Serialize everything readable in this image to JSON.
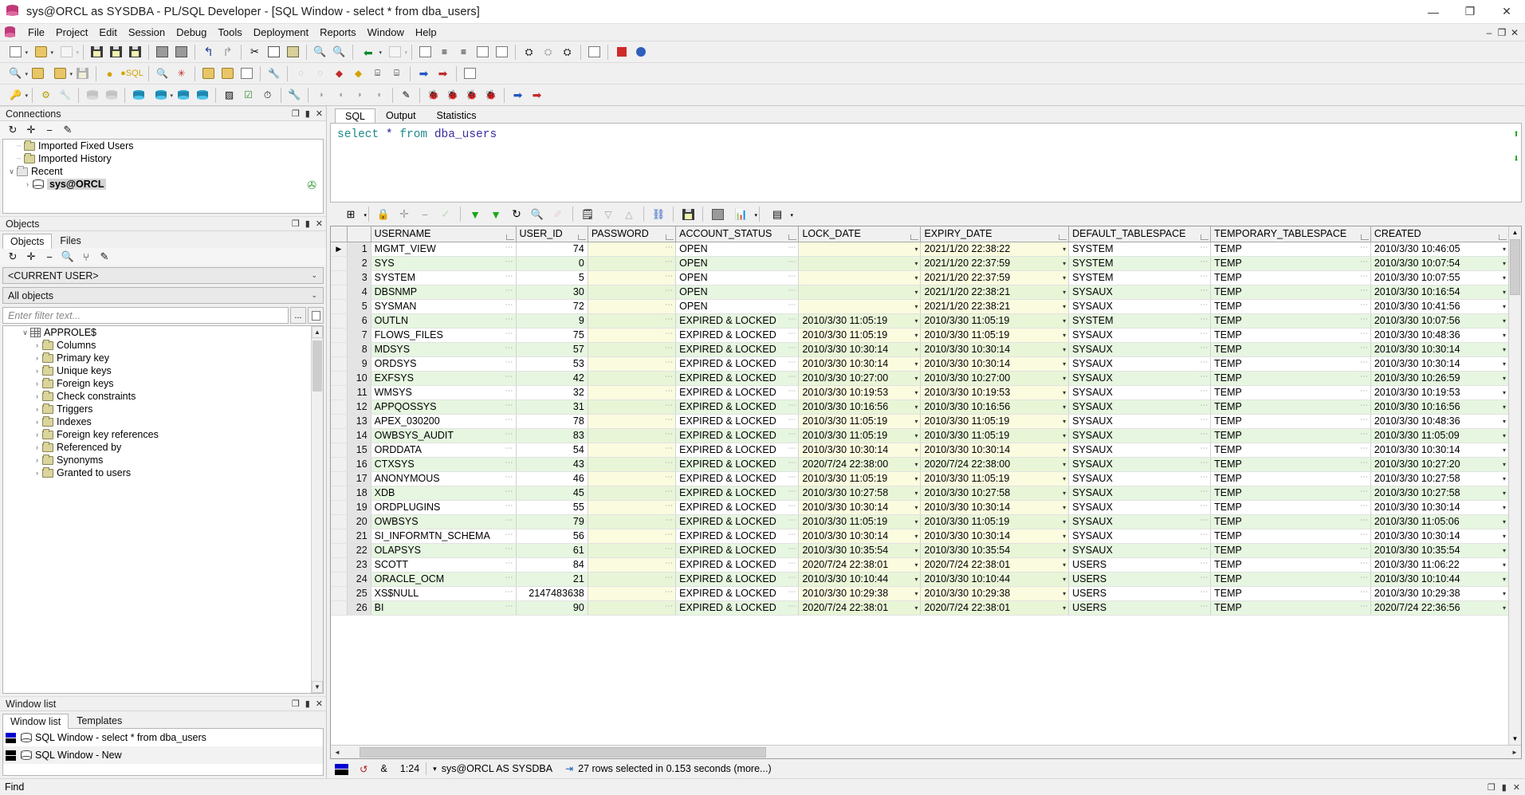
{
  "window": {
    "title": "sys@ORCL as SYSDBA - PL/SQL Developer - [SQL Window - select * from dba_users]",
    "minimize": "—",
    "maximize": "❐",
    "close": "✕",
    "mdi_minimize": "–",
    "mdi_restore": "❐",
    "mdi_close": "✕"
  },
  "menu": {
    "items": [
      "File",
      "Project",
      "Edit",
      "Session",
      "Debug",
      "Tools",
      "Deployment",
      "Reports",
      "Window",
      "Help"
    ]
  },
  "connections_panel": {
    "title": "Connections",
    "controls": {
      "float": "❐",
      "pin": "▮",
      "close": "✕"
    },
    "toolbar": [
      "refresh-icon",
      "add-icon",
      "remove-icon",
      "edit-icon"
    ],
    "tree": [
      {
        "label": "Imported Fixed Users",
        "icon": "folder-icon",
        "expander": "",
        "level": 1
      },
      {
        "label": "Imported History",
        "icon": "folder-icon",
        "expander": "",
        "level": 1
      },
      {
        "label": "Recent",
        "icon": "folder-grey-icon",
        "expander": "∨",
        "level": 0
      },
      {
        "label": "sys@ORCL",
        "icon": "connection-icon",
        "expander": "›",
        "level": 2,
        "selected": true
      }
    ]
  },
  "objects_panel": {
    "title": "Objects",
    "controls": {
      "float": "❐",
      "pin": "▮",
      "close": "✕"
    },
    "tabs": [
      {
        "label": "Objects",
        "active": true
      },
      {
        "label": "Files",
        "active": false
      }
    ],
    "toolbar": [
      "refresh-icon",
      "add-icon",
      "remove-icon",
      "find-icon",
      "filter-icon",
      "edit-icon"
    ],
    "user_select": "<CURRENT USER>",
    "object_select": "All objects",
    "filter_placeholder": "Enter filter text...",
    "filter_buttons": [
      "...",
      "report-icon"
    ],
    "tree": [
      {
        "label": "APPROLE$",
        "icon": "table-icon",
        "expander": "∨",
        "level": 1
      },
      {
        "label": "Columns",
        "icon": "folder-icon",
        "expander": "›",
        "level": 2
      },
      {
        "label": "Primary key",
        "icon": "folder-icon",
        "expander": "›",
        "level": 2
      },
      {
        "label": "Unique keys",
        "icon": "folder-icon",
        "expander": "›",
        "level": 2
      },
      {
        "label": "Foreign keys",
        "icon": "folder-icon",
        "expander": "›",
        "level": 2
      },
      {
        "label": "Check constraints",
        "icon": "folder-icon",
        "expander": "›",
        "level": 2
      },
      {
        "label": "Triggers",
        "icon": "folder-icon",
        "expander": "›",
        "level": 2
      },
      {
        "label": "Indexes",
        "icon": "folder-icon",
        "expander": "›",
        "level": 2
      },
      {
        "label": "Foreign key references",
        "icon": "folder-icon",
        "expander": "›",
        "level": 2
      },
      {
        "label": "Referenced by",
        "icon": "folder-icon",
        "expander": "›",
        "level": 2
      },
      {
        "label": "Synonyms",
        "icon": "folder-icon",
        "expander": "›",
        "level": 2
      },
      {
        "label": "Granted to users",
        "icon": "folder-icon",
        "expander": "›",
        "level": 2
      }
    ]
  },
  "window_list_panel": {
    "title": "Window list",
    "controls": {
      "float": "❐",
      "pin": "▮",
      "close": "✕"
    },
    "tabs": [
      {
        "label": "Window list",
        "active": true
      },
      {
        "label": "Templates",
        "active": false
      }
    ],
    "items": [
      {
        "label": "SQL Window - select * from dba_users",
        "active": true
      },
      {
        "label": "SQL Window - New",
        "active": false
      }
    ]
  },
  "editor": {
    "tabs": [
      {
        "label": "SQL",
        "active": true
      },
      {
        "label": "Output",
        "active": false
      },
      {
        "label": "Statistics",
        "active": false
      }
    ],
    "sql_tokens": [
      {
        "text": "select",
        "type": "keyword"
      },
      {
        "text": " ",
        "type": "plain"
      },
      {
        "text": "*",
        "type": "star"
      },
      {
        "text": " ",
        "type": "plain"
      },
      {
        "text": "from",
        "type": "keyword"
      },
      {
        "text": " ",
        "type": "plain"
      },
      {
        "text": "dba_users",
        "type": "identifier"
      }
    ],
    "sql_text": "select * from dba_users"
  },
  "grid_toolbar": {
    "buttons": [
      "grid-layout-icon",
      "lock-icon",
      "insert-row-icon",
      "delete-row-icon",
      "post-changes-icon",
      "export-all-icon",
      "fetch-all-icon",
      "refresh-icon",
      "find-icon",
      "clear-icon",
      "copy-data-icon",
      "sort-desc-icon",
      "sort-asc-icon",
      "link-icon",
      "save-icon",
      "print-icon",
      "chart-icon",
      "table-view-icon"
    ]
  },
  "grid": {
    "columns": [
      "USERNAME",
      "USER_ID",
      "PASSWORD",
      "ACCOUNT_STATUS",
      "LOCK_DATE",
      "EXPIRY_DATE",
      "DEFAULT_TABLESPACE",
      "TEMPORARY_TABLESPACE",
      "CREATED"
    ],
    "rows": [
      {
        "n": 1,
        "USERNAME": "MGMT_VIEW",
        "USER_ID": "74",
        "PASSWORD": "",
        "ACCOUNT_STATUS": "OPEN",
        "LOCK_DATE": "",
        "EXPIRY_DATE": "2021/1/20 22:38:22",
        "DEFAULT_TABLESPACE": "SYSTEM",
        "TEMPORARY_TABLESPACE": "TEMP",
        "CREATED": "2010/3/30 10:46:05"
      },
      {
        "n": 2,
        "USERNAME": "SYS",
        "USER_ID": "0",
        "PASSWORD": "",
        "ACCOUNT_STATUS": "OPEN",
        "LOCK_DATE": "",
        "EXPIRY_DATE": "2021/1/20 22:37:59",
        "DEFAULT_TABLESPACE": "SYSTEM",
        "TEMPORARY_TABLESPACE": "TEMP",
        "CREATED": "2010/3/30 10:07:54"
      },
      {
        "n": 3,
        "USERNAME": "SYSTEM",
        "USER_ID": "5",
        "PASSWORD": "",
        "ACCOUNT_STATUS": "OPEN",
        "LOCK_DATE": "",
        "EXPIRY_DATE": "2021/1/20 22:37:59",
        "DEFAULT_TABLESPACE": "SYSTEM",
        "TEMPORARY_TABLESPACE": "TEMP",
        "CREATED": "2010/3/30 10:07:55"
      },
      {
        "n": 4,
        "USERNAME": "DBSNMP",
        "USER_ID": "30",
        "PASSWORD": "",
        "ACCOUNT_STATUS": "OPEN",
        "LOCK_DATE": "",
        "EXPIRY_DATE": "2021/1/20 22:38:21",
        "DEFAULT_TABLESPACE": "SYSAUX",
        "TEMPORARY_TABLESPACE": "TEMP",
        "CREATED": "2010/3/30 10:16:54"
      },
      {
        "n": 5,
        "USERNAME": "SYSMAN",
        "USER_ID": "72",
        "PASSWORD": "",
        "ACCOUNT_STATUS": "OPEN",
        "LOCK_DATE": "",
        "EXPIRY_DATE": "2021/1/20 22:38:21",
        "DEFAULT_TABLESPACE": "SYSAUX",
        "TEMPORARY_TABLESPACE": "TEMP",
        "CREATED": "2010/3/30 10:41:56"
      },
      {
        "n": 6,
        "USERNAME": "OUTLN",
        "USER_ID": "9",
        "PASSWORD": "",
        "ACCOUNT_STATUS": "EXPIRED & LOCKED",
        "LOCK_DATE": "2010/3/30 11:05:19",
        "EXPIRY_DATE": "2010/3/30 11:05:19",
        "DEFAULT_TABLESPACE": "SYSTEM",
        "TEMPORARY_TABLESPACE": "TEMP",
        "CREATED": "2010/3/30 10:07:56"
      },
      {
        "n": 7,
        "USERNAME": "FLOWS_FILES",
        "USER_ID": "75",
        "PASSWORD": "",
        "ACCOUNT_STATUS": "EXPIRED & LOCKED",
        "LOCK_DATE": "2010/3/30 11:05:19",
        "EXPIRY_DATE": "2010/3/30 11:05:19",
        "DEFAULT_TABLESPACE": "SYSAUX",
        "TEMPORARY_TABLESPACE": "TEMP",
        "CREATED": "2010/3/30 10:48:36"
      },
      {
        "n": 8,
        "USERNAME": "MDSYS",
        "USER_ID": "57",
        "PASSWORD": "",
        "ACCOUNT_STATUS": "EXPIRED & LOCKED",
        "LOCK_DATE": "2010/3/30 10:30:14",
        "EXPIRY_DATE": "2010/3/30 10:30:14",
        "DEFAULT_TABLESPACE": "SYSAUX",
        "TEMPORARY_TABLESPACE": "TEMP",
        "CREATED": "2010/3/30 10:30:14"
      },
      {
        "n": 9,
        "USERNAME": "ORDSYS",
        "USER_ID": "53",
        "PASSWORD": "",
        "ACCOUNT_STATUS": "EXPIRED & LOCKED",
        "LOCK_DATE": "2010/3/30 10:30:14",
        "EXPIRY_DATE": "2010/3/30 10:30:14",
        "DEFAULT_TABLESPACE": "SYSAUX",
        "TEMPORARY_TABLESPACE": "TEMP",
        "CREATED": "2010/3/30 10:30:14"
      },
      {
        "n": 10,
        "USERNAME": "EXFSYS",
        "USER_ID": "42",
        "PASSWORD": "",
        "ACCOUNT_STATUS": "EXPIRED & LOCKED",
        "LOCK_DATE": "2010/3/30 10:27:00",
        "EXPIRY_DATE": "2010/3/30 10:27:00",
        "DEFAULT_TABLESPACE": "SYSAUX",
        "TEMPORARY_TABLESPACE": "TEMP",
        "CREATED": "2010/3/30 10:26:59"
      },
      {
        "n": 11,
        "USERNAME": "WMSYS",
        "USER_ID": "32",
        "PASSWORD": "",
        "ACCOUNT_STATUS": "EXPIRED & LOCKED",
        "LOCK_DATE": "2010/3/30 10:19:53",
        "EXPIRY_DATE": "2010/3/30 10:19:53",
        "DEFAULT_TABLESPACE": "SYSAUX",
        "TEMPORARY_TABLESPACE": "TEMP",
        "CREATED": "2010/3/30 10:19:53"
      },
      {
        "n": 12,
        "USERNAME": "APPQOSSYS",
        "USER_ID": "31",
        "PASSWORD": "",
        "ACCOUNT_STATUS": "EXPIRED & LOCKED",
        "LOCK_DATE": "2010/3/30 10:16:56",
        "EXPIRY_DATE": "2010/3/30 10:16:56",
        "DEFAULT_TABLESPACE": "SYSAUX",
        "TEMPORARY_TABLESPACE": "TEMP",
        "CREATED": "2010/3/30 10:16:56"
      },
      {
        "n": 13,
        "USERNAME": "APEX_030200",
        "USER_ID": "78",
        "PASSWORD": "",
        "ACCOUNT_STATUS": "EXPIRED & LOCKED",
        "LOCK_DATE": "2010/3/30 11:05:19",
        "EXPIRY_DATE": "2010/3/30 11:05:19",
        "DEFAULT_TABLESPACE": "SYSAUX",
        "TEMPORARY_TABLESPACE": "TEMP",
        "CREATED": "2010/3/30 10:48:36"
      },
      {
        "n": 14,
        "USERNAME": "OWBSYS_AUDIT",
        "USER_ID": "83",
        "PASSWORD": "",
        "ACCOUNT_STATUS": "EXPIRED & LOCKED",
        "LOCK_DATE": "2010/3/30 11:05:19",
        "EXPIRY_DATE": "2010/3/30 11:05:19",
        "DEFAULT_TABLESPACE": "SYSAUX",
        "TEMPORARY_TABLESPACE": "TEMP",
        "CREATED": "2010/3/30 11:05:09"
      },
      {
        "n": 15,
        "USERNAME": "ORDDATA",
        "USER_ID": "54",
        "PASSWORD": "",
        "ACCOUNT_STATUS": "EXPIRED & LOCKED",
        "LOCK_DATE": "2010/3/30 10:30:14",
        "EXPIRY_DATE": "2010/3/30 10:30:14",
        "DEFAULT_TABLESPACE": "SYSAUX",
        "TEMPORARY_TABLESPACE": "TEMP",
        "CREATED": "2010/3/30 10:30:14"
      },
      {
        "n": 16,
        "USERNAME": "CTXSYS",
        "USER_ID": "43",
        "PASSWORD": "",
        "ACCOUNT_STATUS": "EXPIRED & LOCKED",
        "LOCK_DATE": "2020/7/24 22:38:00",
        "EXPIRY_DATE": "2020/7/24 22:38:00",
        "DEFAULT_TABLESPACE": "SYSAUX",
        "TEMPORARY_TABLESPACE": "TEMP",
        "CREATED": "2010/3/30 10:27:20"
      },
      {
        "n": 17,
        "USERNAME": "ANONYMOUS",
        "USER_ID": "46",
        "PASSWORD": "",
        "ACCOUNT_STATUS": "EXPIRED & LOCKED",
        "LOCK_DATE": "2010/3/30 11:05:19",
        "EXPIRY_DATE": "2010/3/30 11:05:19",
        "DEFAULT_TABLESPACE": "SYSAUX",
        "TEMPORARY_TABLESPACE": "TEMP",
        "CREATED": "2010/3/30 10:27:58"
      },
      {
        "n": 18,
        "USERNAME": "XDB",
        "USER_ID": "45",
        "PASSWORD": "",
        "ACCOUNT_STATUS": "EXPIRED & LOCKED",
        "LOCK_DATE": "2010/3/30 10:27:58",
        "EXPIRY_DATE": "2010/3/30 10:27:58",
        "DEFAULT_TABLESPACE": "SYSAUX",
        "TEMPORARY_TABLESPACE": "TEMP",
        "CREATED": "2010/3/30 10:27:58"
      },
      {
        "n": 19,
        "USERNAME": "ORDPLUGINS",
        "USER_ID": "55",
        "PASSWORD": "",
        "ACCOUNT_STATUS": "EXPIRED & LOCKED",
        "LOCK_DATE": "2010/3/30 10:30:14",
        "EXPIRY_DATE": "2010/3/30 10:30:14",
        "DEFAULT_TABLESPACE": "SYSAUX",
        "TEMPORARY_TABLESPACE": "TEMP",
        "CREATED": "2010/3/30 10:30:14"
      },
      {
        "n": 20,
        "USERNAME": "OWBSYS",
        "USER_ID": "79",
        "PASSWORD": "",
        "ACCOUNT_STATUS": "EXPIRED & LOCKED",
        "LOCK_DATE": "2010/3/30 11:05:19",
        "EXPIRY_DATE": "2010/3/30 11:05:19",
        "DEFAULT_TABLESPACE": "SYSAUX",
        "TEMPORARY_TABLESPACE": "TEMP",
        "CREATED": "2010/3/30 11:05:06"
      },
      {
        "n": 21,
        "USERNAME": "SI_INFORMTN_SCHEMA",
        "USER_ID": "56",
        "PASSWORD": "",
        "ACCOUNT_STATUS": "EXPIRED & LOCKED",
        "LOCK_DATE": "2010/3/30 10:30:14",
        "EXPIRY_DATE": "2010/3/30 10:30:14",
        "DEFAULT_TABLESPACE": "SYSAUX",
        "TEMPORARY_TABLESPACE": "TEMP",
        "CREATED": "2010/3/30 10:30:14"
      },
      {
        "n": 22,
        "USERNAME": "OLAPSYS",
        "USER_ID": "61",
        "PASSWORD": "",
        "ACCOUNT_STATUS": "EXPIRED & LOCKED",
        "LOCK_DATE": "2010/3/30 10:35:54",
        "EXPIRY_DATE": "2010/3/30 10:35:54",
        "DEFAULT_TABLESPACE": "SYSAUX",
        "TEMPORARY_TABLESPACE": "TEMP",
        "CREATED": "2010/3/30 10:35:54"
      },
      {
        "n": 23,
        "USERNAME": "SCOTT",
        "USER_ID": "84",
        "PASSWORD": "",
        "ACCOUNT_STATUS": "EXPIRED & LOCKED",
        "LOCK_DATE": "2020/7/24 22:38:01",
        "EXPIRY_DATE": "2020/7/24 22:38:01",
        "DEFAULT_TABLESPACE": "USERS",
        "TEMPORARY_TABLESPACE": "TEMP",
        "CREATED": "2010/3/30 11:06:22"
      },
      {
        "n": 24,
        "USERNAME": "ORACLE_OCM",
        "USER_ID": "21",
        "PASSWORD": "",
        "ACCOUNT_STATUS": "EXPIRED & LOCKED",
        "LOCK_DATE": "2010/3/30 10:10:44",
        "EXPIRY_DATE": "2010/3/30 10:10:44",
        "DEFAULT_TABLESPACE": "USERS",
        "TEMPORARY_TABLESPACE": "TEMP",
        "CREATED": "2010/3/30 10:10:44"
      },
      {
        "n": 25,
        "USERNAME": "XS$NULL",
        "USER_ID": "2147483638",
        "PASSWORD": "",
        "ACCOUNT_STATUS": "EXPIRED & LOCKED",
        "LOCK_DATE": "2010/3/30 10:29:38",
        "EXPIRY_DATE": "2010/3/30 10:29:38",
        "DEFAULT_TABLESPACE": "USERS",
        "TEMPORARY_TABLESPACE": "TEMP",
        "CREATED": "2010/3/30 10:29:38"
      },
      {
        "n": 26,
        "USERNAME": "BI",
        "USER_ID": "90",
        "PASSWORD": "",
        "ACCOUNT_STATUS": "EXPIRED & LOCKED",
        "LOCK_DATE": "2020/7/24 22:38:01",
        "EXPIRY_DATE": "2020/7/24 22:38:01",
        "DEFAULT_TABLESPACE": "USERS",
        "TEMPORARY_TABLESPACE": "TEMP",
        "CREATED": "2020/7/24 22:36:56"
      }
    ]
  },
  "statusbar": {
    "cursor_position": "1:24",
    "connection": "sys@ORCL AS SYSDBA",
    "result_message": "27 rows selected in 0.153 seconds (more...)",
    "edit_indicator": "↺",
    "amp_indicator": "&"
  },
  "findbar": {
    "label": "Find",
    "controls": {
      "float": "❐",
      "pin": "▮",
      "close": "✕"
    }
  }
}
